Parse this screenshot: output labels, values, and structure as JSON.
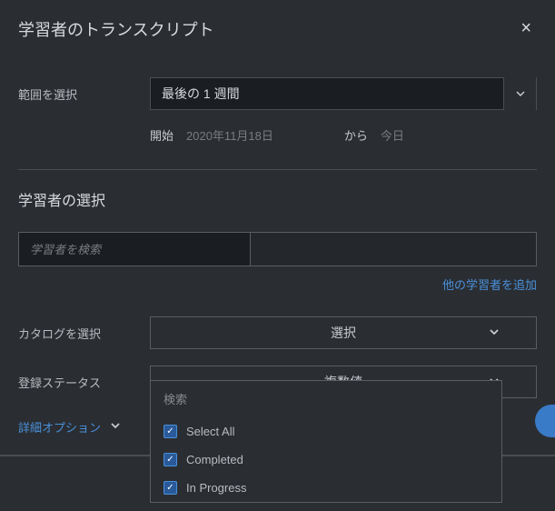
{
  "header": {
    "title": "学習者のトランスクリプト",
    "close": "×"
  },
  "range": {
    "label": "範囲を選択",
    "value": "最後の 1 週間",
    "start_label": "開始",
    "start_date": "2020年11月18日",
    "to_label": "から",
    "end_date": "今日"
  },
  "learners": {
    "section_title": "学習者の選択",
    "search_placeholder": "学習者を検索",
    "add_link": "他の学習者を追加"
  },
  "catalog": {
    "label": "カタログを選択",
    "value": "選択"
  },
  "status": {
    "label": "登録ステータス",
    "value": "複数値",
    "dropdown": {
      "search": "検索",
      "items": [
        {
          "label": "Select All",
          "checked": true
        },
        {
          "label": "Completed",
          "checked": true
        },
        {
          "label": "In Progress",
          "checked": true
        }
      ]
    }
  },
  "advanced": {
    "label": "詳細オプション"
  }
}
